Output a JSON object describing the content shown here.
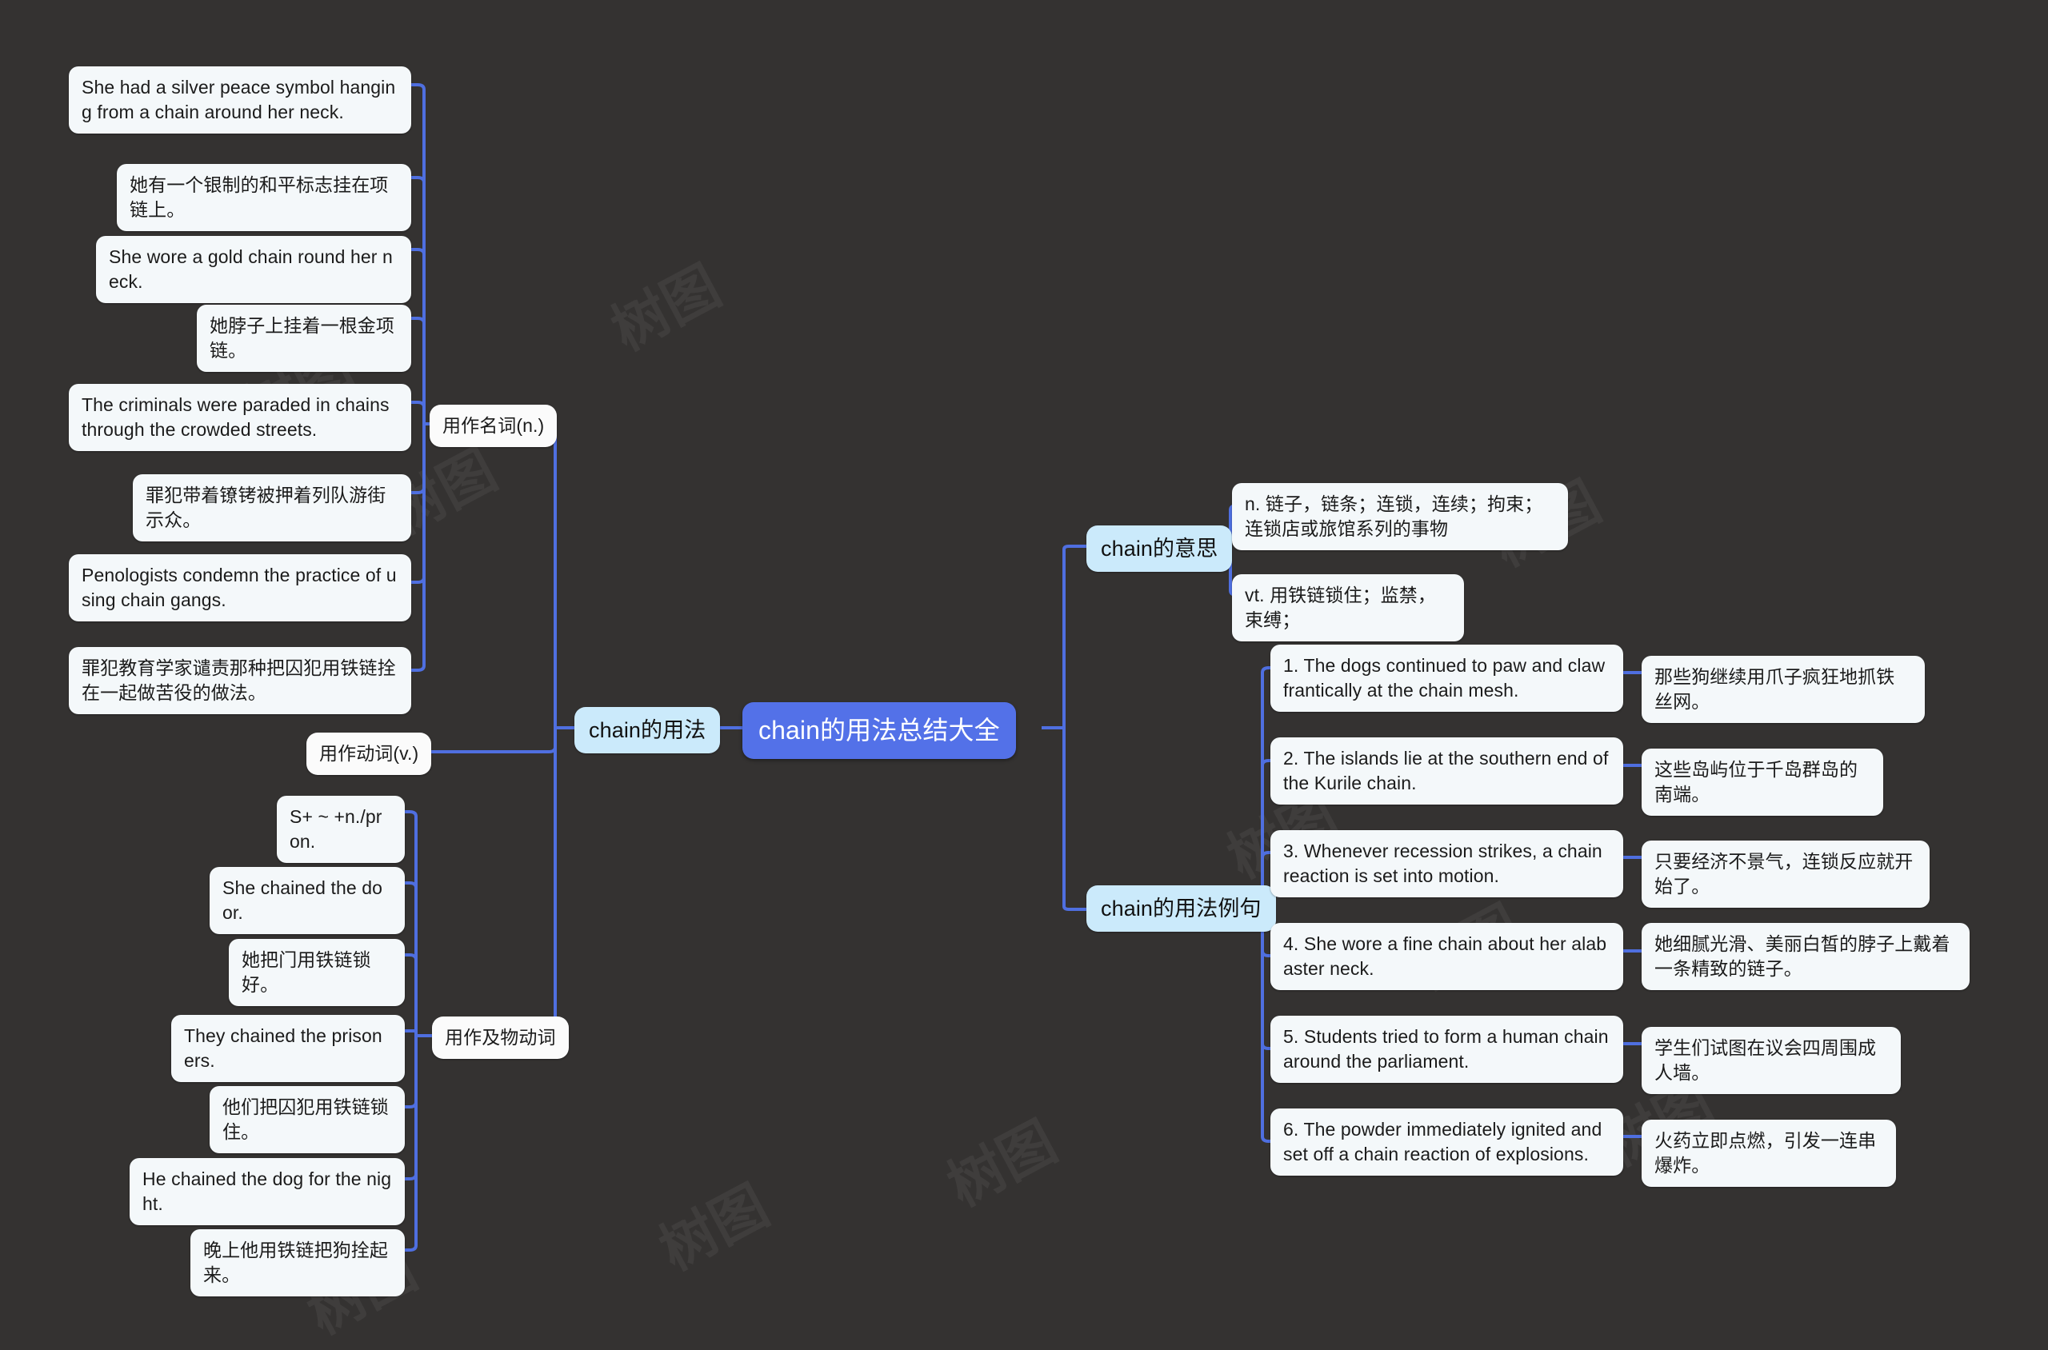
{
  "theme": {
    "background": "#343231",
    "root_fill": "#5371e8",
    "root_text": "#ffffff",
    "category_fill": "#cbeafb",
    "leaf_fill": "#f4f8fa",
    "link_color": "#4f6fe0",
    "text_color": "#1b1b1b"
  },
  "root": {
    "label": "chain的用法总结大全"
  },
  "watermark": {
    "text": "树图"
  },
  "left_branch": {
    "label": "chain的用法",
    "children": [
      {
        "label": "用作名词(n.)",
        "items": [
          {
            "en": "She had a silver peace symbol hanging from a chain around her neck.",
            "zh": "她有一个银制的和平标志挂在项链上。"
          },
          {
            "en": "She wore a gold chain round her neck.",
            "zh": "她脖子上挂着一根金项链。"
          },
          {
            "en": "The criminals were paraded in chains through the crowded streets.",
            "zh": "罪犯带着镣铐被押着列队游街示众。"
          },
          {
            "en": "Penologists condemn the practice of using chain gangs.",
            "zh": "罪犯教育学家谴责那种把囚犯用铁链拴在一起做苦役的做法。"
          }
        ]
      },
      {
        "label": "用作动词(v.)",
        "items": []
      },
      {
        "label": "用作及物动词",
        "items": [
          {
            "pattern": "S+ ~ +n./pron."
          },
          {
            "en": "She chained the door.",
            "zh": "她把门用铁链锁好。"
          },
          {
            "en": "They chained the prisoners.",
            "zh": "他们把囚犯用铁链锁住。"
          },
          {
            "en": "He chained the dog for the night.",
            "zh": "晚上他用铁链把狗拴起来。"
          }
        ]
      }
    ]
  },
  "right_branches": [
    {
      "label": "chain的意思",
      "items": [
        {
          "text": "n. 链子，链条；连锁，连续；拘束；连锁店或旅馆系列的事物"
        },
        {
          "text": "vt. 用铁链锁住；监禁，束缚；"
        }
      ]
    },
    {
      "label": "chain的用法例句",
      "examples": [
        {
          "en": "1. The dogs continued to paw and claw frantically at the chain mesh.",
          "zh": "那些狗继续用爪子疯狂地抓铁丝网。"
        },
        {
          "en": "2. The islands lie at the southern end of the Kurile chain.",
          "zh": "这些岛屿位于千岛群岛的南端。"
        },
        {
          "en": "3. Whenever recession strikes, a chain reaction is set into motion.",
          "zh": "只要经济不景气，连锁反应就开始了。"
        },
        {
          "en": "4. She wore a fine chain about her alabaster neck.",
          "zh": "她细腻光滑、美丽白皙的脖子上戴着一条精致的链子。"
        },
        {
          "en": "5. Students tried to form a human chain around the parliament.",
          "zh": "学生们试图在议会四周围成人墙。"
        },
        {
          "en": "6. The powder immediately ignited and set off a chain reaction of explosions.",
          "zh": "火药立即点燃，引发一连串爆炸。"
        }
      ]
    }
  ]
}
